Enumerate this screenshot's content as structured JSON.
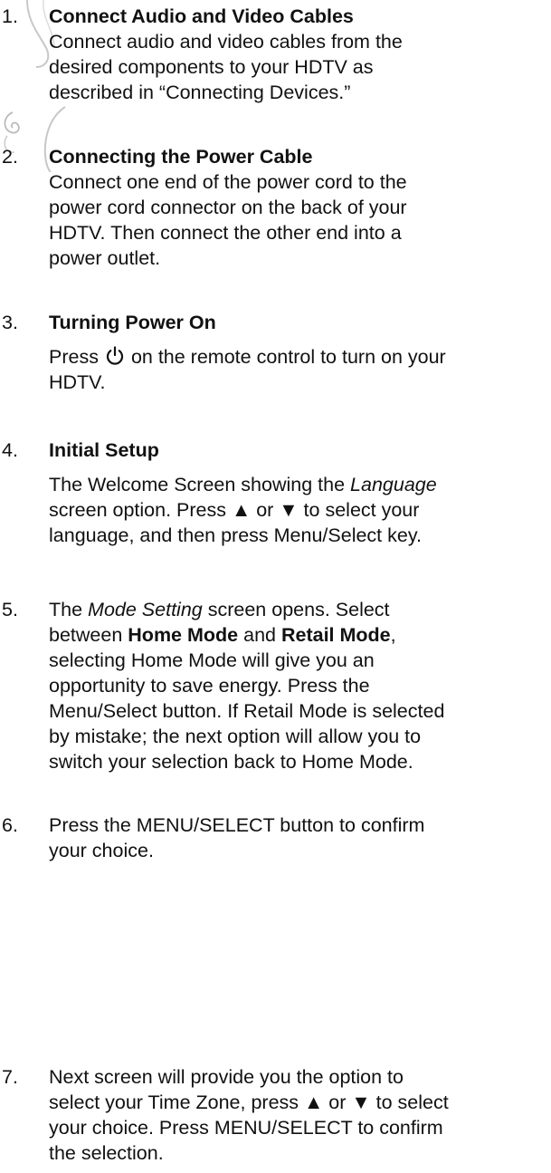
{
  "items": [
    {
      "number": "1.",
      "heading": "Connect Audio and Video Cables",
      "lines": [
        "Connect audio and video cables from the",
        "desired components to your HDTV as",
        "described in “Connecting Devices.”"
      ]
    },
    {
      "number": "2.",
      "heading": "Connecting the Power Cable",
      "lines": [
        "Connect one end of the power cord to the",
        "power cord connector on the back of your",
        "HDTV. Then connect the other end into a",
        "power outlet."
      ]
    },
    {
      "number": "3.",
      "heading": "Turning Power On",
      "line1_before": "Press",
      "line1_after": "on the remote control to turn on your",
      "line2": "HDTV."
    },
    {
      "number": "4.",
      "heading": "Initial Setup",
      "l1_before": "The Welcome Screen showing the",
      "l1_italic": "Language",
      "l2": "screen option. Press ▲ or ▼ to select your",
      "l3": "language, and then press Menu/Select key."
    },
    {
      "number": "5.",
      "l1_before": "The",
      "l1_italic": "Mode Setting",
      "l1_after": "screen opens. Select",
      "l2_before": "between",
      "l2_bold1": "Home Mode",
      "l2_mid": "and",
      "l2_bold2": "Retail Mode",
      "l2_after": ",",
      "lines_rest": [
        "selecting Home Mode will give you an",
        "opportunity to save energy. Press the",
        "Menu/Select button. If Retail Mode is selected",
        "by mistake; the next option will allow you to",
        "switch your selection back to Home Mode."
      ]
    },
    {
      "number": "6.",
      "lines": [
        "Press the MENU/SELECT button to confirm",
        "your choice."
      ]
    },
    {
      "number": "7.",
      "lines": [
        "Next screen will provide you the option to",
        "select your Time Zone, press ▲ or ▼ to select",
        "your choice. Press MENU/SELECT to confirm",
        "the selection."
      ]
    }
  ],
  "icons": {
    "power": "power-icon",
    "decoration": "swirl-decoration"
  },
  "colors": {
    "text": "#111111",
    "decoration": "#c8c8c8"
  }
}
